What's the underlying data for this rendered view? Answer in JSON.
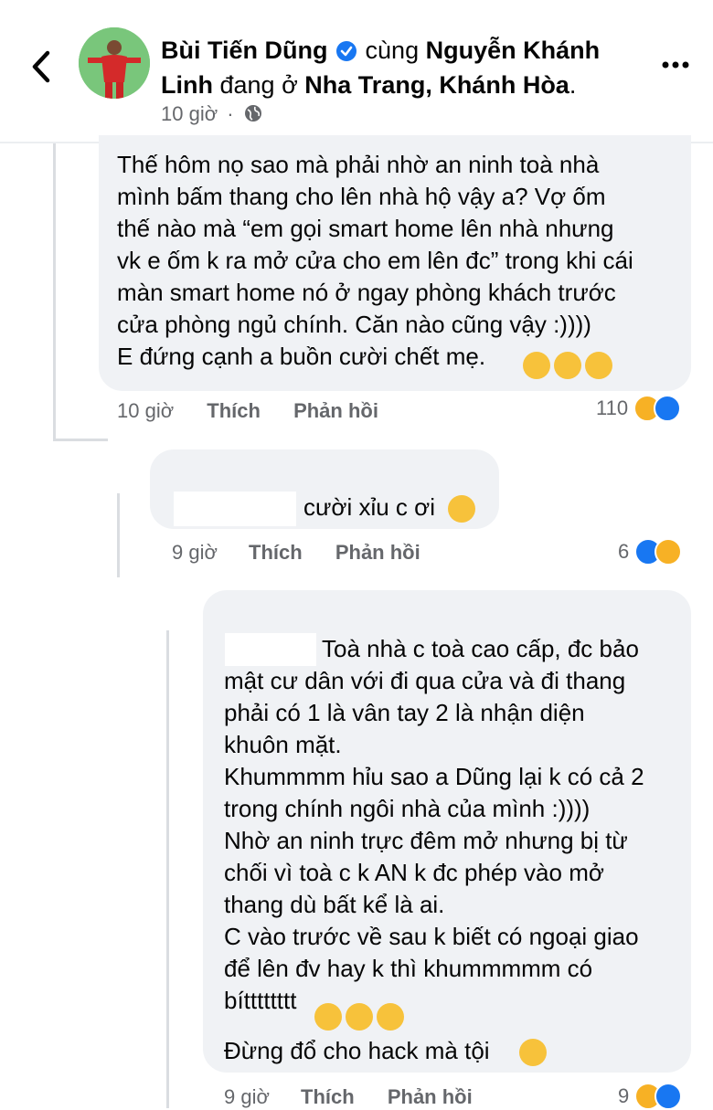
{
  "header": {
    "author": "Bùi Tiến Dũng",
    "with_word": "cùng",
    "tagged": "Nguyễn Khánh Linh",
    "location_word": "đang ở",
    "location": "Nha Trang, Khánh Hòa",
    "period": ".",
    "time": "10 giờ",
    "dot": "·"
  },
  "comments": [
    {
      "text": "Thế hôm nọ sao mà phải nhờ an ninh toà nhà\nmình bấm thang cho lên nhà hộ vậy a? Vợ ốm\nthế nào mà “em gọi smart home lên nhà nhưng\nvk e ốm k ra mở cửa cho em lên đc” trong khi cái\nmàn smart home nó ở ngay phòng khách trước\ncửa phòng ngủ chính. Căn nào cũng vậy :))))\nE đứng cạnh a buồn cười chết mẹ.",
      "time": "10 giờ",
      "like": "Thích",
      "reply": "Phản hồi",
      "count": "110"
    },
    {
      "text": "cười xỉu c ơi",
      "time": "9 giờ",
      "like": "Thích",
      "reply": "Phản hồi",
      "count": "6"
    },
    {
      "text_first": "Toà nhà c toà cao cấp, đc bảo",
      "text": "mật cư dân với đi qua cửa và đi thang\nphải có 1 là vân tay 2 là nhận diện\nkhuôn mặt.\nKhummmm hỉu sao a Dũng lại k có cả 2\ntrong chính ngôi nhà của mình :))))\nNhờ an ninh trực đêm mở nhưng bị từ\nchối vì toà c k AN k đc phép vào mở\nthang dù bất kể là ai.\nC vào trước về sau k biết có ngoại giao\nđể lên đv hay k thì khummmmm có\nbítttttttt",
      "last_line": "Đừng đổ cho hack mà tội",
      "time": "9 giờ",
      "like": "Thích",
      "reply": "Phản hồi",
      "count": "9"
    }
  ],
  "colors": {
    "bubble": "#f0f2f5",
    "meta": "#65676b",
    "like_blue": "#1877f2",
    "haha_yellow": "#f7b125"
  }
}
